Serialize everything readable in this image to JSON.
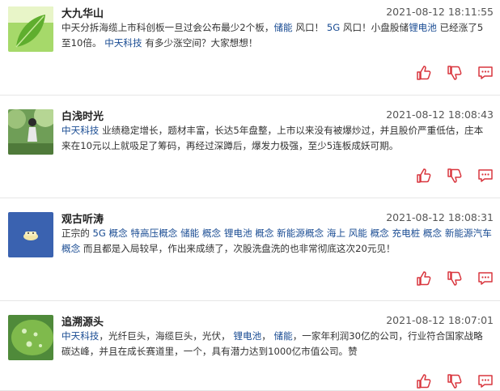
{
  "posts": [
    {
      "username": "大九华山",
      "timestamp": "2021-08-12 18:11:55",
      "segments": [
        {
          "t": "中天分拆海缆上市科创板一旦过会公布最少2个板，"
        },
        {
          "t": "储能",
          "tag": true
        },
        {
          "t": "风口！"
        },
        {
          "t": "5G",
          "tag": true
        },
        {
          "t": "风口！小盘股储"
        },
        {
          "t": "锂电池",
          "tag": true
        },
        {
          "t": "已经涨了5至10倍。"
        },
        {
          "t": "中天科技",
          "tag": true
        },
        {
          "t": "有多少涨空间？大家想想！"
        }
      ]
    },
    {
      "username": "白浅时光",
      "timestamp": "2021-08-12 18:08:43",
      "segments": [
        {
          "t": "中天科技",
          "tag": true
        },
        {
          "t": "业绩稳定增长，题材丰富，长达5年盘整，上市以来没有被爆炒过，并且股价严重低估，庄本来在10元以上就吸足了筹码，再经过深蹲后，爆发力极强，至少5连板成妖可期。"
        }
      ]
    },
    {
      "username": "观古听涛",
      "timestamp": "2021-08-12 18:08:31",
      "segments": [
        {
          "t": "正宗的"
        },
        {
          "t": "5G 概念",
          "tag": true
        },
        {
          "t": "特高压概念",
          "tag": true
        },
        {
          "t": "储能 概念",
          "tag": true
        },
        {
          "t": "锂电池 概念",
          "tag": true
        },
        {
          "t": "新能源概念",
          "tag": true
        },
        {
          "t": "海上 风能 概念",
          "tag": true
        },
        {
          "t": "充电桩 概念",
          "tag": true
        },
        {
          "t": "新能源汽车 概念",
          "tag": true
        },
        {
          "t": "而且都是入局较早，作出来成绩了，次股洗盘洗的也非常彻底这次20元见！"
        }
      ]
    },
    {
      "username": "追溯源头",
      "timestamp": "2021-08-12 18:07:01",
      "segments": [
        {
          "t": "中天科技",
          "tag": true
        },
        {
          "t": "，光纤巨头，海缆巨头，光伏，"
        },
        {
          "t": "锂电池",
          "tag": true
        },
        {
          "t": "，"
        },
        {
          "t": "储能",
          "tag": true
        },
        {
          "t": "，一家年利润30亿的公司，行业符合国家战略碳达峰，并且在成长赛道里，一个，具有潜力达到1000亿市值公司。赞"
        }
      ]
    }
  ],
  "icons": {
    "like": "thumbs-up-icon",
    "dislike": "thumbs-down-icon",
    "comment": "comment-icon"
  },
  "colors": {
    "icon_red": "#d9363e",
    "tag_blue": "#1a4c93",
    "divider": "#e6e6e6"
  }
}
